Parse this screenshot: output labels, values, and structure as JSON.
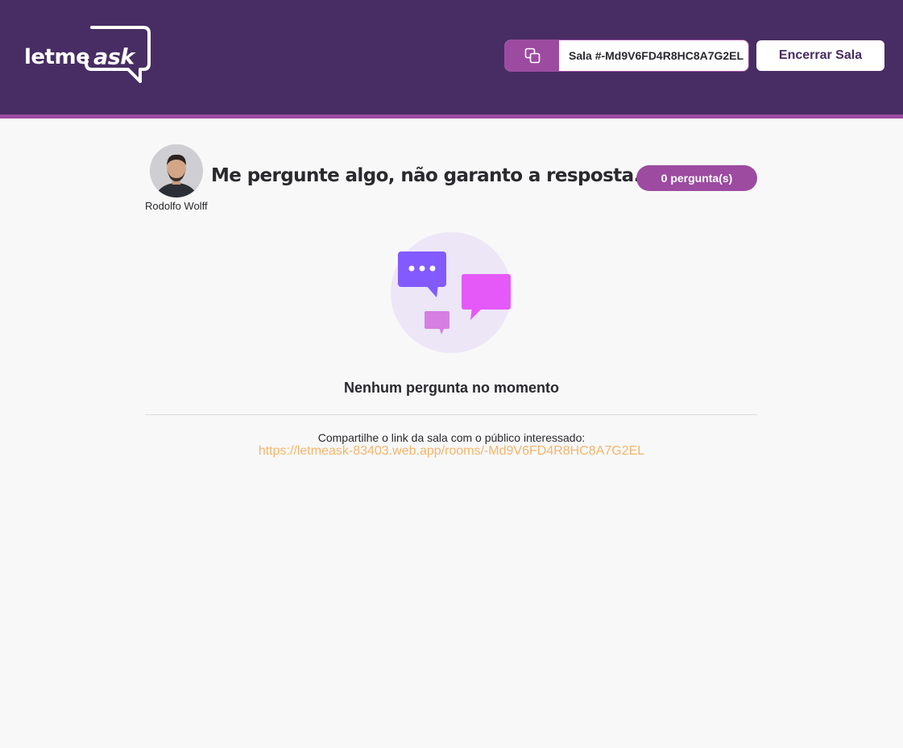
{
  "header": {
    "logo": {
      "word1": "letme",
      "word2": "ask"
    },
    "room_code": {
      "label": "Sala #-Md9V6FD4R8HC8A7G2EL",
      "copy_icon": "copy-icon"
    },
    "end_room_label": "Encerrar Sala"
  },
  "room": {
    "author_name": "Rodolfo Wolff",
    "title": "Me pergunte algo, não garanto a resposta.",
    "question_count": "0 pergunta(s)"
  },
  "empty_state": {
    "illustration": "speech-bubbles-icon",
    "title": "Nenhum pergunta no momento"
  },
  "share": {
    "text": "Compartilhe o link da sala com o público interessado:",
    "link": "https://letmeask-83403.web.app/rooms/-Md9V6FD4R8HC8A7G2EL"
  },
  "colors": {
    "header_bg": "#472d63",
    "accent": "#9c4ba0",
    "link": "#f5b46a",
    "background": "#f8f8f8"
  }
}
